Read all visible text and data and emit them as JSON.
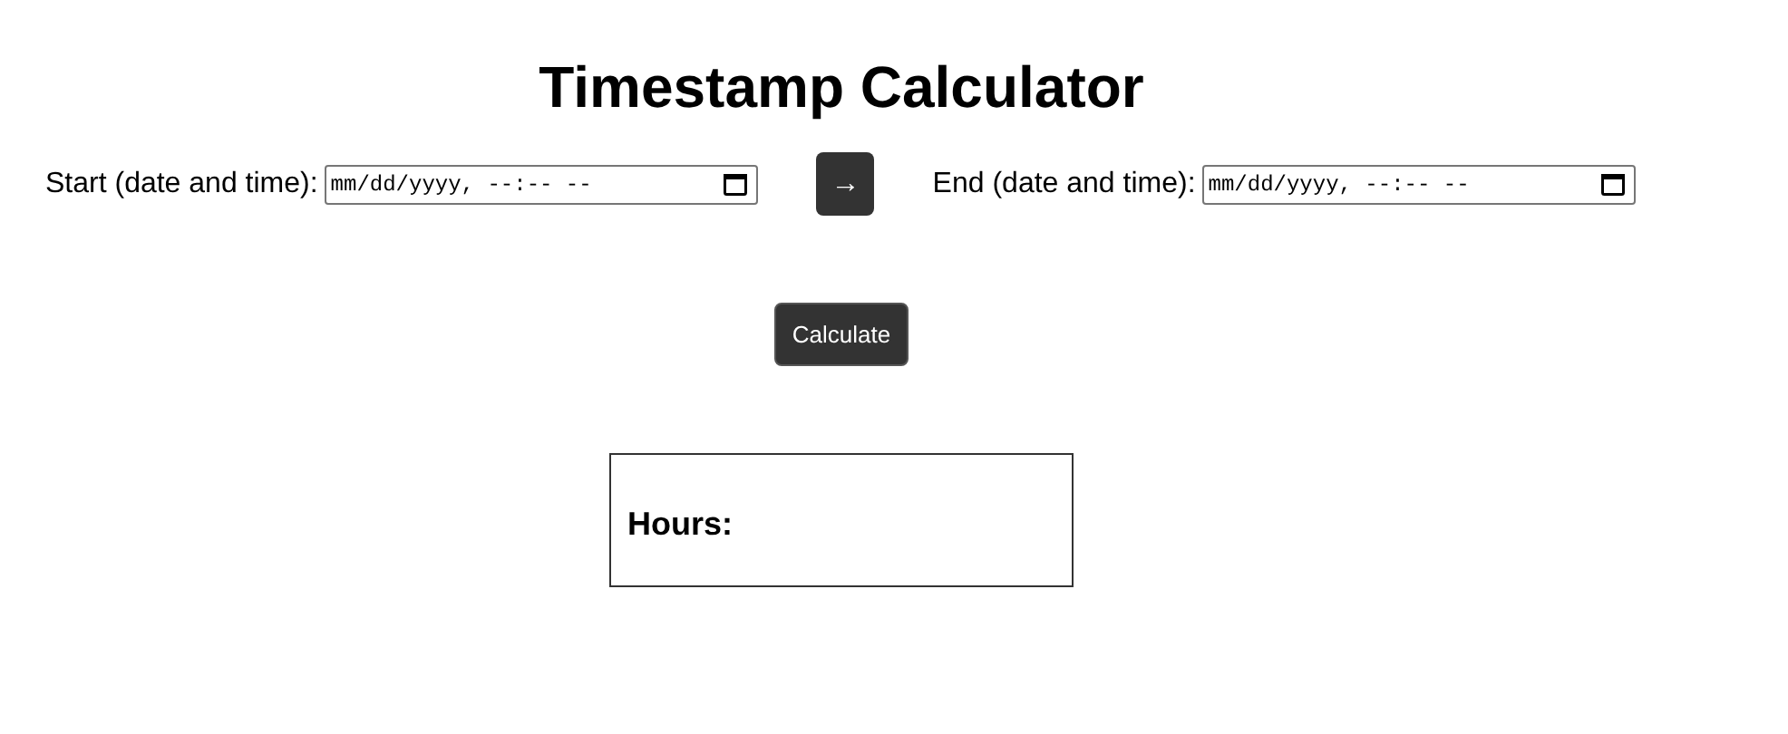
{
  "title": "Timestamp Calculator",
  "start": {
    "label": "Start (date and time):",
    "placeholder": "mm/dd/yyyy, --:-- --"
  },
  "swap_button": {
    "label": "→"
  },
  "end": {
    "label": "End (date and time):",
    "placeholder": "mm/dd/yyyy, --:-- --"
  },
  "calculate_button": {
    "label": "Calculate"
  },
  "result": {
    "label": "Hours:"
  }
}
